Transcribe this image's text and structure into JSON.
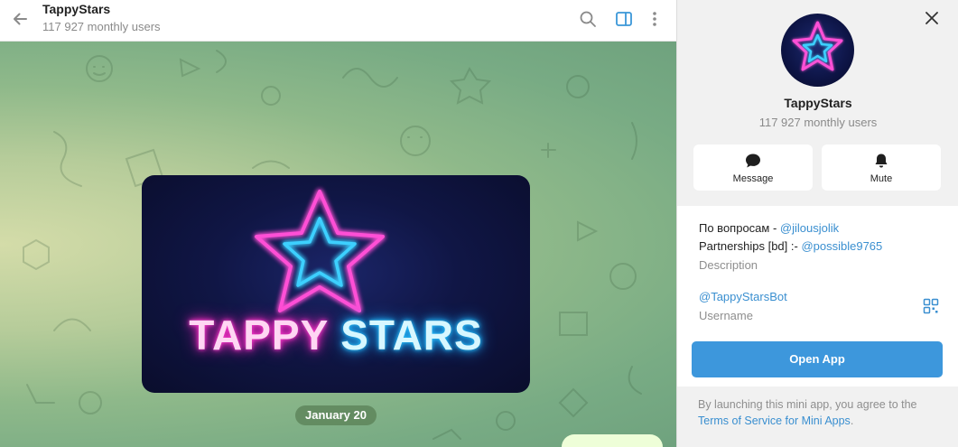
{
  "header": {
    "title": "TappyStars",
    "subtitle": "117 927 monthly users",
    "icons": [
      "back-arrow-icon",
      "search-icon",
      "sidebar-toggle-icon",
      "more-vertical-icon"
    ]
  },
  "chat": {
    "banner": {
      "word1": "TAPPY",
      "word2": "STARS"
    },
    "date_label": "January 20",
    "message_preview": "· · ·"
  },
  "panel": {
    "title": "TappyStars",
    "subtitle": "117 927 monthly users",
    "actions": [
      {
        "label": "Message",
        "icon": "message-bubble-icon"
      },
      {
        "label": "Mute",
        "icon": "bell-icon"
      }
    ],
    "description": {
      "line1_prefix": "По вопросам - ",
      "line1_link": "@jilousjolik",
      "line2_prefix": "Partnerships [bd] :- ",
      "line2_link": "@possible9765",
      "caption": "Description"
    },
    "username": {
      "value": "@TappyStarsBot",
      "caption": "Username"
    },
    "open_button": "Open App",
    "terms_prefix": "By launching this mini app, you agree to the",
    "terms_link": "Terms of Service for Mini Apps",
    "terms_suffix": "."
  },
  "colors": {
    "accent": "#3d97dc",
    "link": "#3a8fd0",
    "neon_pink": "#ff2bc4",
    "neon_cyan": "#1fb4ff",
    "date_pill": "#5b8257"
  }
}
